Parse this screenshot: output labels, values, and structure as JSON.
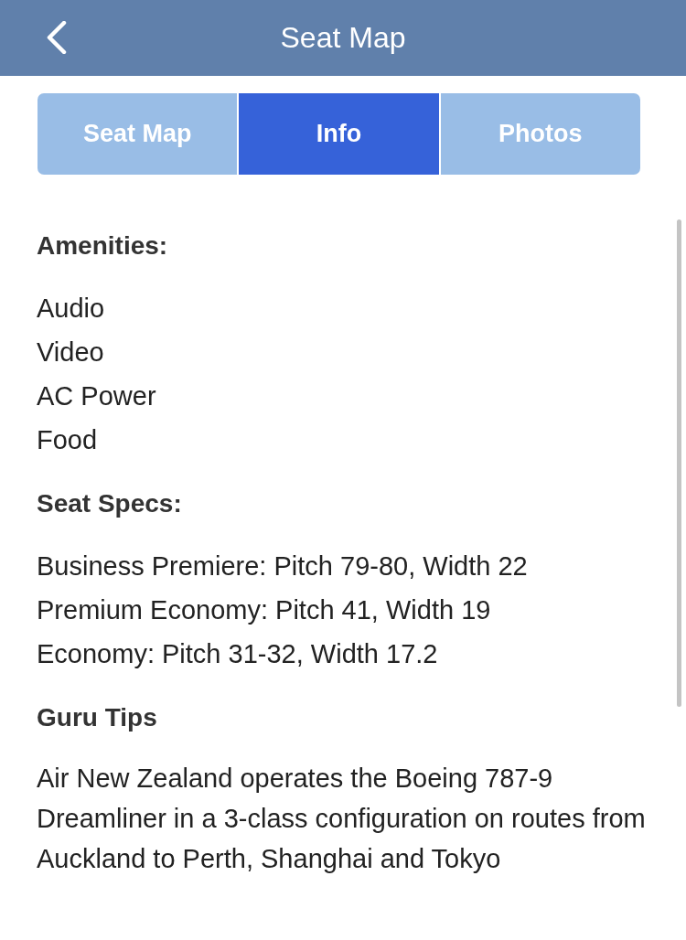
{
  "header": {
    "title": "Seat Map"
  },
  "tabs": [
    {
      "label": "Seat Map",
      "selected": false
    },
    {
      "label": "Info",
      "selected": true
    },
    {
      "label": "Photos",
      "selected": false
    }
  ],
  "sections": [
    {
      "heading": "Amenities:",
      "lines": [
        "Audio",
        "Video",
        "AC Power",
        "Food"
      ]
    },
    {
      "heading": "Seat Specs:",
      "lines": [
        "Business Premiere: Pitch 79-80, Width 22",
        "Premium Economy: Pitch 41, Width 19",
        "Economy: Pitch 31-32, Width 17.2"
      ]
    },
    {
      "heading": "Guru Tips",
      "lines": [
        "Air New Zealand operates the Boeing 787-9 Dreamliner in a 3-class configuration on routes from Auckland to Perth, Shanghai and Tokyo"
      ]
    }
  ]
}
